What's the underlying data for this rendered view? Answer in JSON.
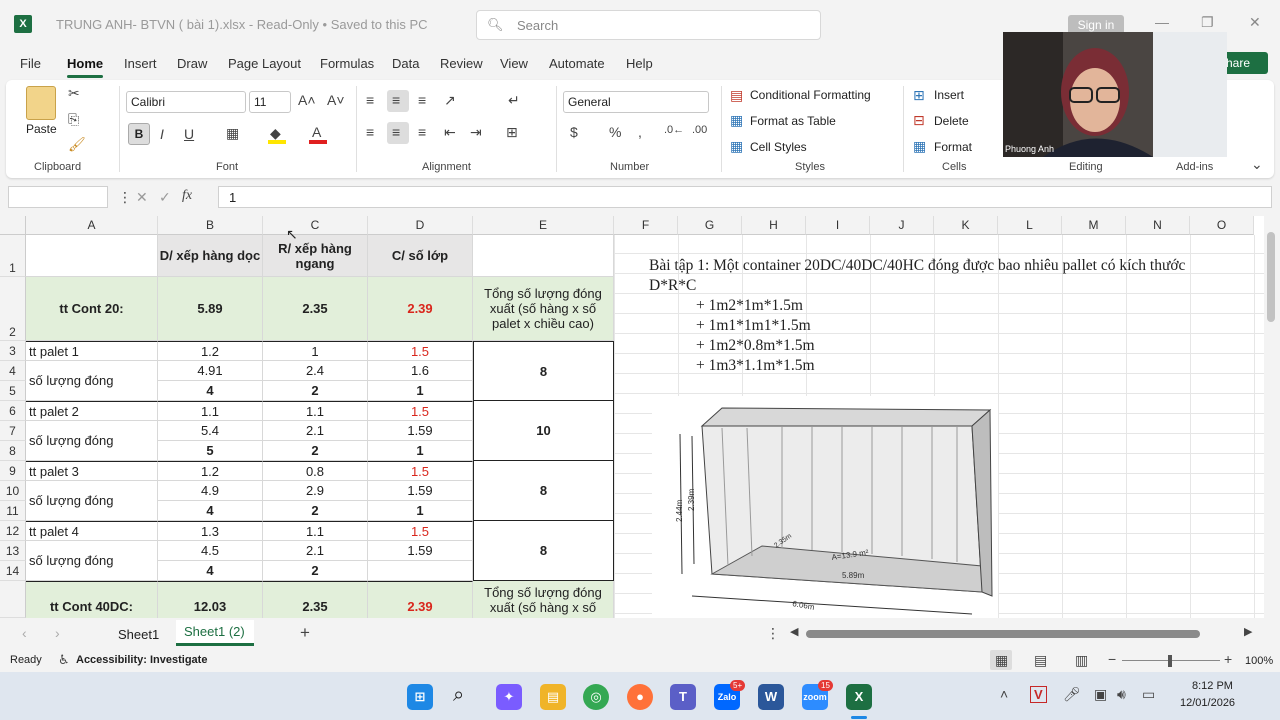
{
  "titlebar": {
    "title": "TRUNG ANH- BTVN ( bài 1).xlsx  -  Read-Only  •  Saved to this PC",
    "logo": "X",
    "search_placeholder": "Search",
    "sign_in": "Sign in",
    "share": "hare"
  },
  "menu": [
    "File",
    "Home",
    "Insert",
    "Draw",
    "Page Layout",
    "Formulas",
    "Data",
    "Review",
    "View",
    "Automate",
    "Help"
  ],
  "ribbon": {
    "paste": "Paste",
    "clipboard": "Clipboard",
    "font_name": "Calibri",
    "font_size": "11",
    "font": "Font",
    "alignment": "Alignment",
    "number_format": "General",
    "number": "Number",
    "cond_format": "Conditional Formatting",
    "format_table": "Format as Table",
    "cell_styles": "Cell Styles",
    "styles": "Styles",
    "insert": "Insert",
    "delete": "Delete",
    "format": "Format",
    "cells": "Cells",
    "editing": "Editing",
    "addins": "Add-ins",
    "bold": "B",
    "italic": "I",
    "underline": "U"
  },
  "formula": {
    "namebox": "",
    "fx": "fx",
    "value": "1"
  },
  "columns": [
    "A",
    "B",
    "C",
    "D",
    "E",
    "F",
    "G",
    "H",
    "I",
    "J",
    "K",
    "L",
    "M",
    "N",
    "O"
  ],
  "rows": [
    "1",
    "2",
    "3",
    "4",
    "5",
    "6",
    "7",
    "8",
    "9",
    "10",
    "11",
    "12",
    "13",
    "14",
    ""
  ],
  "table": {
    "h_b": "D/ xếp hàng dọc",
    "h_c": "R/ xếp hàng ngang",
    "h_d": "C/ số lớp",
    "cont20": "tt Cont 20:",
    "c20_b": "5.89",
    "c20_c": "2.35",
    "c20_d": "2.39",
    "total_label": "Tổng số lượng đóng xuất (số hàng x số palet x chiều cao)",
    "p1": "tt palet 1",
    "p1_b": "1.2",
    "p1_c": "1",
    "p1_d": "1.5",
    "sl": "số lượng đóng",
    "p1r4b": "4.91",
    "p1r4c": "2.4",
    "p1r4d": "1.6",
    "p1r5b": "4",
    "p1r5c": "2",
    "p1r5d": "1",
    "p1_e": "8",
    "p2": "tt palet 2",
    "p2_b": "1.1",
    "p2_c": "1.1",
    "p2_d": "1.5",
    "p2r7b": "5.4",
    "p2r7c": "2.1",
    "p2r7d": "1.59",
    "p2r8b": "5",
    "p2r8c": "2",
    "p2r8d": "1",
    "p2_e": "10",
    "p3": "tt palet 3",
    "p3_b": "1.2",
    "p3_c": "0.8",
    "p3_d": "1.5",
    "p3r10b": "4.9",
    "p3r10c": "2.9",
    "p3r10d": "1.59",
    "p3r11b": "4",
    "p3r11c": "2",
    "p3r11d": "1",
    "p3_e": "8",
    "p4": "tt palet 4",
    "p4_b": "1.3",
    "p4_c": "1.1",
    "p4_d": "1.5",
    "p4r13b": "4.5",
    "p4r13c": "2.1",
    "p4r13d": "1.59",
    "p4r14b": "4",
    "p4r14c": "2",
    "p4_e": "8",
    "cont40": "tt Cont 40DC:",
    "c40_b": "12.03",
    "c40_c": "2.35",
    "c40_d": "2.39",
    "total_label2": "Tổng số lượng đóng xuất (số hàng x số"
  },
  "problem": {
    "title": "Bài tập 1: Một container 20DC/40DC/40HC đóng được bao nhiêu pallet có kích thước D*R*C",
    "l1": "+ 1m2*1m*1.5m",
    "l2": "+ 1m1*1m1*1.5m",
    "l3": "+ 1m2*0.8m*1.5m",
    "l4": "+ 1m3*1.1m*1.5m"
  },
  "container_labels": {
    "h1": "2.39m",
    "h2": "2.44m",
    "w": "2.35m",
    "area": "A=13.9 m²",
    "l1": "5.89m",
    "l2": "6.06m"
  },
  "sheets": [
    "Sheet1",
    "Sheet1 (2)"
  ],
  "status": {
    "ready": "Ready",
    "accessibility": "Accessibility: Investigate",
    "zoom": "100%"
  },
  "webcam": {
    "name": "Phuong Anh"
  },
  "taskbar": {
    "time": "8:12 PM",
    "date": "12/01/2026",
    "badge_zalo": "5+",
    "badge_zoom": "15"
  }
}
